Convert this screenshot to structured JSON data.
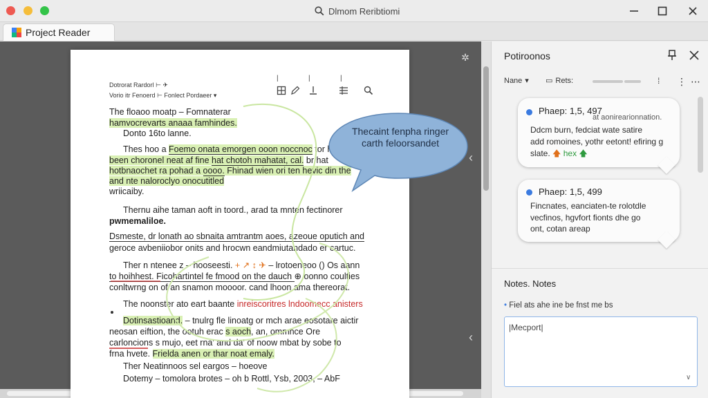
{
  "window": {
    "title": "Dlmom Reribtiomi",
    "tab_label": "Project Reader",
    "search_icon": "search-icon",
    "controls": [
      "minimize-icon",
      "maximize-icon",
      "close-icon"
    ]
  },
  "document": {
    "header": {
      "line1": "Dotrorat Rardorl   ⊢   ✈",
      "line2": "Vorio itr Fenoerd  ⊢   Fonlect Pordaeer  ▾"
    },
    "lines": [
      {
        "a": "The floaoo moatp  –  Fomnaterar",
        "b": ""
      },
      {
        "a": "hamvocrevarts anaaa famhindes.",
        "b": ""
      },
      {
        "a": "Donto 16to lanne.",
        "b": ""
      },
      {
        "a": "Thes hoo a ",
        "b": "Foemo onata emorgen ooon noccnoc",
        "c": " tor he"
      },
      {
        "a": "been choronel neat af fine ",
        "b": "hat chotoh mahatat, cal.",
        "c": "  br  hat"
      },
      {
        "a": "hotbnaochet ra pohad a ",
        "b": "oooo.",
        "c": " Fhinad wien ori ten hevic din the"
      },
      {
        "a": "and nte naloroclyo onocutitled",
        "b": ""
      },
      {
        "a": "wriicaiby.",
        "b": ""
      },
      {
        "a": "Thernu aihe taman aoft in toord., arad ta mnten fectinorer",
        "b": ""
      },
      {
        "a": "pwmemaliloe.",
        "b": ""
      },
      {
        "a": "Dsmeste, dr lonath ao sbnaita amtrantm aoes, azeoue oputich and",
        "b": ""
      },
      {
        "a": "geroce avbeniiobor onits and  hrocwn eandmiutandado er cartuc.",
        "b": ""
      },
      {
        "a": "Ther n ntenee z  –  hooseesti.",
        "b": "  + ↗ ↕ ✈ ",
        "c": "  –  lrotoeneoo () Os aann"
      },
      {
        "a": "to hoihhest.  Ficohartintel fe fmood  ",
        "b": "on the dauch ",
        "c": "⊕ oonno coulties"
      },
      {
        "a": "conltwrng on of an snamon moooor.  cand lhoon ama thereorat.",
        "b": ""
      },
      {
        "a": "The noonster ato eart baante ",
        "b": "inreiscoritres lndoomecc anisters",
        "c": ""
      },
      {
        "a": "Dotinsastioand.",
        "b": "  –  tnulrg ",
        "c": "fle linoatg  or  mch  arae  eosotare  aictir"
      },
      {
        "a": "neosan eiftion,   the   ootuh  erac  ",
        "b": "s aoch",
        "c": ",  an,  ommnce  Ore"
      },
      {
        "a": "carloncions  s  mujo,  eet  rna'  and  da'  of  noow mbat by sobe to",
        "b": ""
      },
      {
        "a": "frna hvete.  ",
        "b": "Frielda anen or thar noat emaly.",
        "c": ""
      },
      {
        "a": "Ther Neatinnoos sel eargos  –  hoeove",
        "b": ""
      },
      {
        "a": "Dotemy  –  tomolora brotes  –  oh b Rottl,   Ysb, 2003,  –  AbF",
        "b": ""
      }
    ],
    "callout_text": "Thecaint fenpha ringer carth feloorsandet",
    "tools": [
      "crop-icon",
      "pen-icon",
      "stamp-icon",
      "list-icon",
      "zoom-icon"
    ]
  },
  "panel": {
    "title": "Potiroonos",
    "filters": {
      "sort_label": "Nane",
      "reply_label": "Rets:"
    },
    "comments": [
      {
        "title": "Phaep: 1,5, 497",
        "side_text": "at aonirearionnation.",
        "body": [
          "Ddcm burn, fedciat wate satire",
          "add romoines, yothr eetont! efiring g",
          "slate."
        ],
        "tag": "hex"
      },
      {
        "title": "Phaep: 1,5, 499",
        "body": [
          "Fincnates, eanciaten-te rolotdle",
          "vecfinos, hgvfort fionts dhe go",
          "ont, cotan areap"
        ]
      }
    ],
    "notes": {
      "title": "Notes. Notes",
      "bullet": "Fiel ats ahe ine be fnst me bs",
      "input_value": "|Mecport|"
    }
  },
  "colors": {
    "highlight": "#d9f0b4",
    "accent": "#3b7be0",
    "callout": "#8fb3d9",
    "annotation_red": "#c62828",
    "annotation_orange": "#e0701a",
    "annotation_green": "#2e9a3e"
  }
}
